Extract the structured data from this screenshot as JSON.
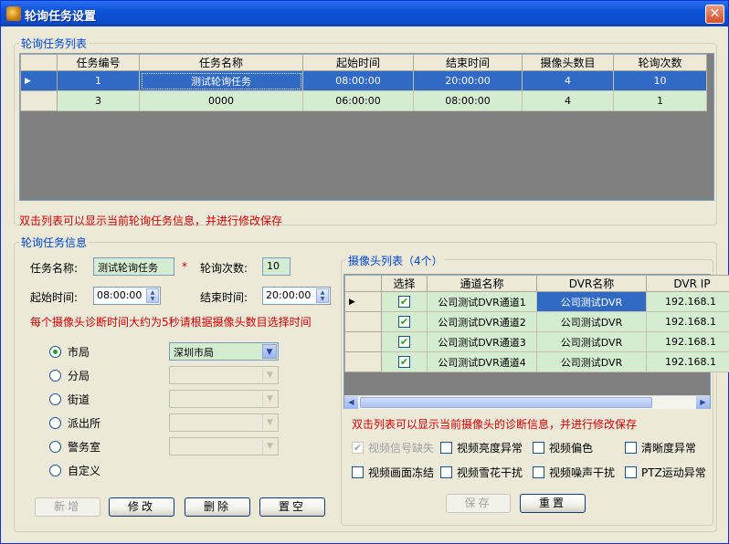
{
  "window": {
    "title": "轮询任务设置",
    "close": "✕"
  },
  "task_list": {
    "legend": "轮询任务列表",
    "columns": [
      "任务编号",
      "任务名称",
      "起始时间",
      "结束时间",
      "摄像头数目",
      "轮询次数"
    ],
    "rows": [
      {
        "id": "1",
        "name": "测试轮询任务",
        "start": "08:00:00",
        "end": "20:00:00",
        "cams": "4",
        "times": "10",
        "selected": true
      },
      {
        "id": "3",
        "name": "0000",
        "start": "06:00:00",
        "end": "08:00:00",
        "cams": "4",
        "times": "1",
        "selected": false
      }
    ],
    "hint": "双击列表可以显示当前轮询任务信息，并进行修改保存"
  },
  "task_info": {
    "legend": "轮询任务信息",
    "name_label": "任务名称:",
    "name_value": "测试轮询任务",
    "required_mark": "*",
    "times_label": "轮询次数:",
    "times_value": "10",
    "start_label": "起始时间:",
    "start_value": "08:00:00",
    "end_label": "结束时间:",
    "end_value": "20:00:00",
    "note": "每个摄像头诊断时间大约为5秒请根据摄像头数目选择时间",
    "levels": [
      {
        "label": "市局",
        "checked": true,
        "combo": "深圳市局",
        "enabled": true
      },
      {
        "label": "分局",
        "checked": false,
        "combo": "",
        "enabled": false
      },
      {
        "label": "街道",
        "checked": false,
        "combo": "",
        "enabled": false
      },
      {
        "label": "派出所",
        "checked": false,
        "combo": "",
        "enabled": false
      },
      {
        "label": "警务室",
        "checked": false,
        "combo": "",
        "enabled": false
      },
      {
        "label": "自定义",
        "checked": false,
        "combo": null,
        "enabled": false
      }
    ],
    "buttons": {
      "add": "新增",
      "edit": "修改",
      "delete": "删除",
      "clear": "置空"
    }
  },
  "camera_list": {
    "legend": "摄像头列表（4个）",
    "columns": [
      "选择",
      "通道名称",
      "DVR名称",
      "DVR IP"
    ],
    "rows": [
      {
        "checked": true,
        "channel": "公司测试DVR通道1",
        "dvr": "公司测试DVR",
        "ip": "192.168.1",
        "selected": true
      },
      {
        "checked": true,
        "channel": "公司测试DVR通道2",
        "dvr": "公司测试DVR",
        "ip": "192.168.1",
        "selected": false
      },
      {
        "checked": true,
        "channel": "公司测试DVR通道3",
        "dvr": "公司测试DVR",
        "ip": "192.168.1",
        "selected": false
      },
      {
        "checked": true,
        "channel": "公司测试DVR通道4",
        "dvr": "公司测试DVR",
        "ip": "192.168.1",
        "selected": false
      }
    ],
    "hint": "双击列表可以显示当前摄像头的诊断信息，并进行修改保存",
    "diagnostics": [
      {
        "label": "视频信号缺失",
        "checked": true,
        "enabled": false
      },
      {
        "label": "视频亮度异常",
        "checked": false,
        "enabled": true
      },
      {
        "label": "视频偏色",
        "checked": false,
        "enabled": true
      },
      {
        "label": "清晰度异常",
        "checked": false,
        "enabled": true
      },
      {
        "label": "视频画面冻结",
        "checked": false,
        "enabled": true
      },
      {
        "label": "视频雪花干扰",
        "checked": false,
        "enabled": true
      },
      {
        "label": "视频噪声干扰",
        "checked": false,
        "enabled": true
      },
      {
        "label": "PTZ运动异常",
        "checked": false,
        "enabled": true
      }
    ],
    "buttons": {
      "save": "保存",
      "reset": "重置"
    }
  }
}
